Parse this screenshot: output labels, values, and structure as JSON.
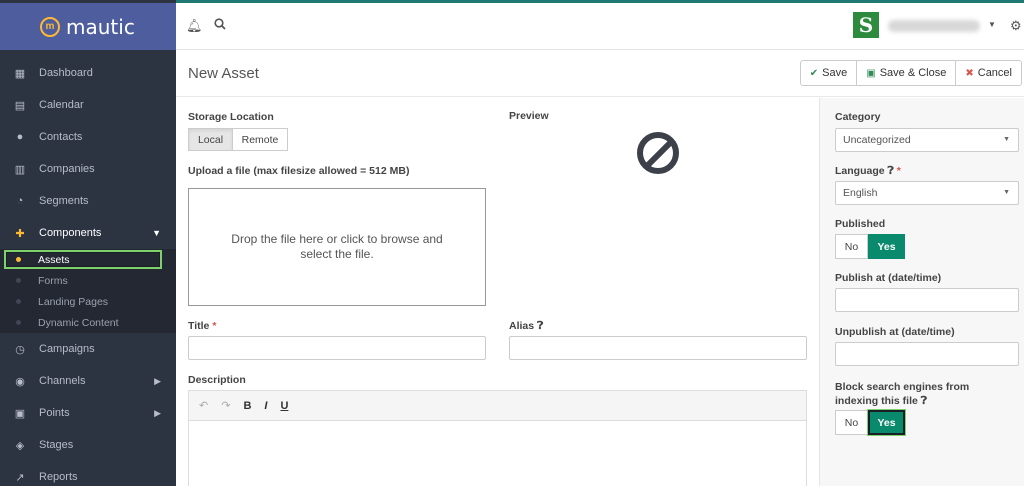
{
  "brand": {
    "name": "mautic",
    "mark": "m"
  },
  "sidebar": {
    "items": [
      {
        "label": "Dashboard",
        "icon": "▦"
      },
      {
        "label": "Calendar",
        "icon": "▤"
      },
      {
        "label": "Contacts",
        "icon": "●"
      },
      {
        "label": "Companies",
        "icon": "▥"
      },
      {
        "label": "Segments",
        "icon": "◔"
      },
      {
        "label": "Components",
        "icon": "✚"
      }
    ],
    "components_sub": [
      "Assets",
      "Forms",
      "Landing Pages",
      "Dynamic Content"
    ],
    "items_after": [
      {
        "label": "Campaigns",
        "icon": "◷"
      },
      {
        "label": "Channels",
        "icon": "◉"
      },
      {
        "label": "Points",
        "icon": "▣"
      },
      {
        "label": "Stages",
        "icon": "◈"
      },
      {
        "label": "Reports",
        "icon": "↗"
      }
    ]
  },
  "header": {
    "avatar_letter": "S",
    "notifications_icon": "bell-icon",
    "search_icon": "search-icon"
  },
  "page": {
    "title": "New Asset",
    "buttons": {
      "save": "Save",
      "save_close": "Save & Close",
      "cancel": "Cancel"
    }
  },
  "form": {
    "storage_label": "Storage Location",
    "storage_options": [
      "Local",
      "Remote"
    ],
    "storage_selected": "Local",
    "upload_label": "Upload a file (max filesize allowed = 512 MB)",
    "dropzone_text": "Drop the file here or click to browse and select the file.",
    "preview_label": "Preview",
    "title_label": "Title",
    "title_value": "",
    "alias_label": "Alias",
    "alias_value": "",
    "description_label": "Description",
    "editor_tools": [
      "↶",
      "↷",
      "B",
      "I",
      "U"
    ]
  },
  "right_panel": {
    "category_label": "Category",
    "category_value": "Uncategorized",
    "language_label": "Language",
    "language_value": "English",
    "published_label": "Published",
    "published_value": "Yes",
    "no_label": "No",
    "yes_label": "Yes",
    "publish_at_label": "Publish at (date/time)",
    "publish_at_value": "",
    "unpublish_at_label": "Unpublish at (date/time)",
    "unpublish_at_value": "",
    "block_search_label": "Block search engines from indexing this file",
    "block_search_value": "Yes"
  }
}
